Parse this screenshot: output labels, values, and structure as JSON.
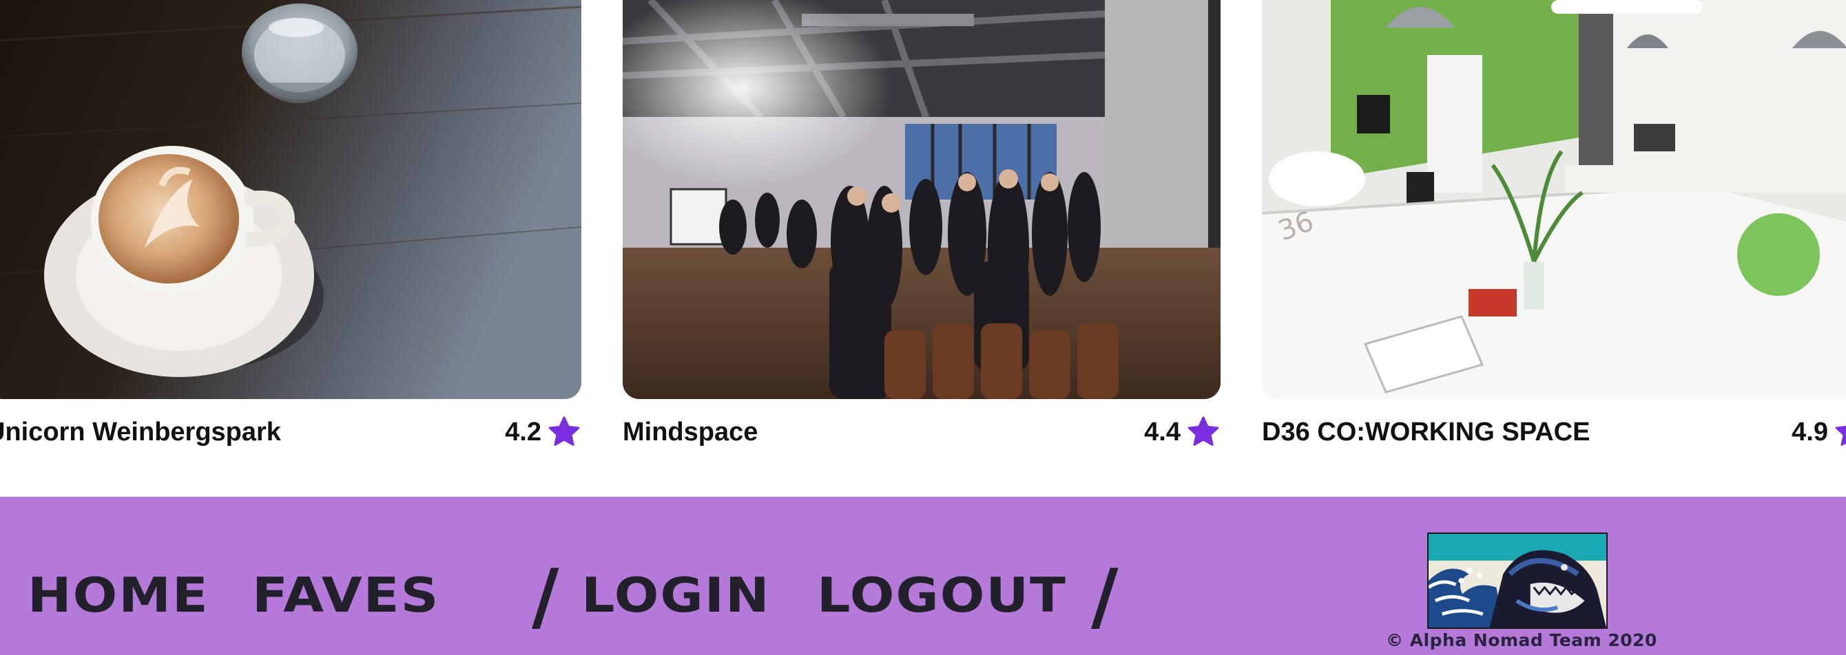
{
  "cards": [
    {
      "title": "Unicorn Weinbergspark",
      "rating": "4.2",
      "image_subject": "latte-on-dark-table"
    },
    {
      "title": "Mindspace",
      "rating": "4.4",
      "image_subject": "crowd-in-industrial-loft"
    },
    {
      "title": "D36 CO:WORKING SPACE",
      "rating": "4.9",
      "image_subject": "white-coworking-room-green-wall"
    }
  ],
  "footer": {
    "nav": {
      "home": "HOME",
      "faves": "FAVES",
      "login": "LOGIN",
      "logout": "LOGOUT",
      "separator": "/"
    },
    "logo_subject": "great-wave-shark-logo",
    "copyright": "© Alpha Nomad Team 2020"
  },
  "colors": {
    "footer_bg": "#b57ad9",
    "nav_text": "#22212b",
    "star": "#7b2ee0",
    "card_title": "#111111"
  },
  "icons": [
    "star-icon"
  ]
}
